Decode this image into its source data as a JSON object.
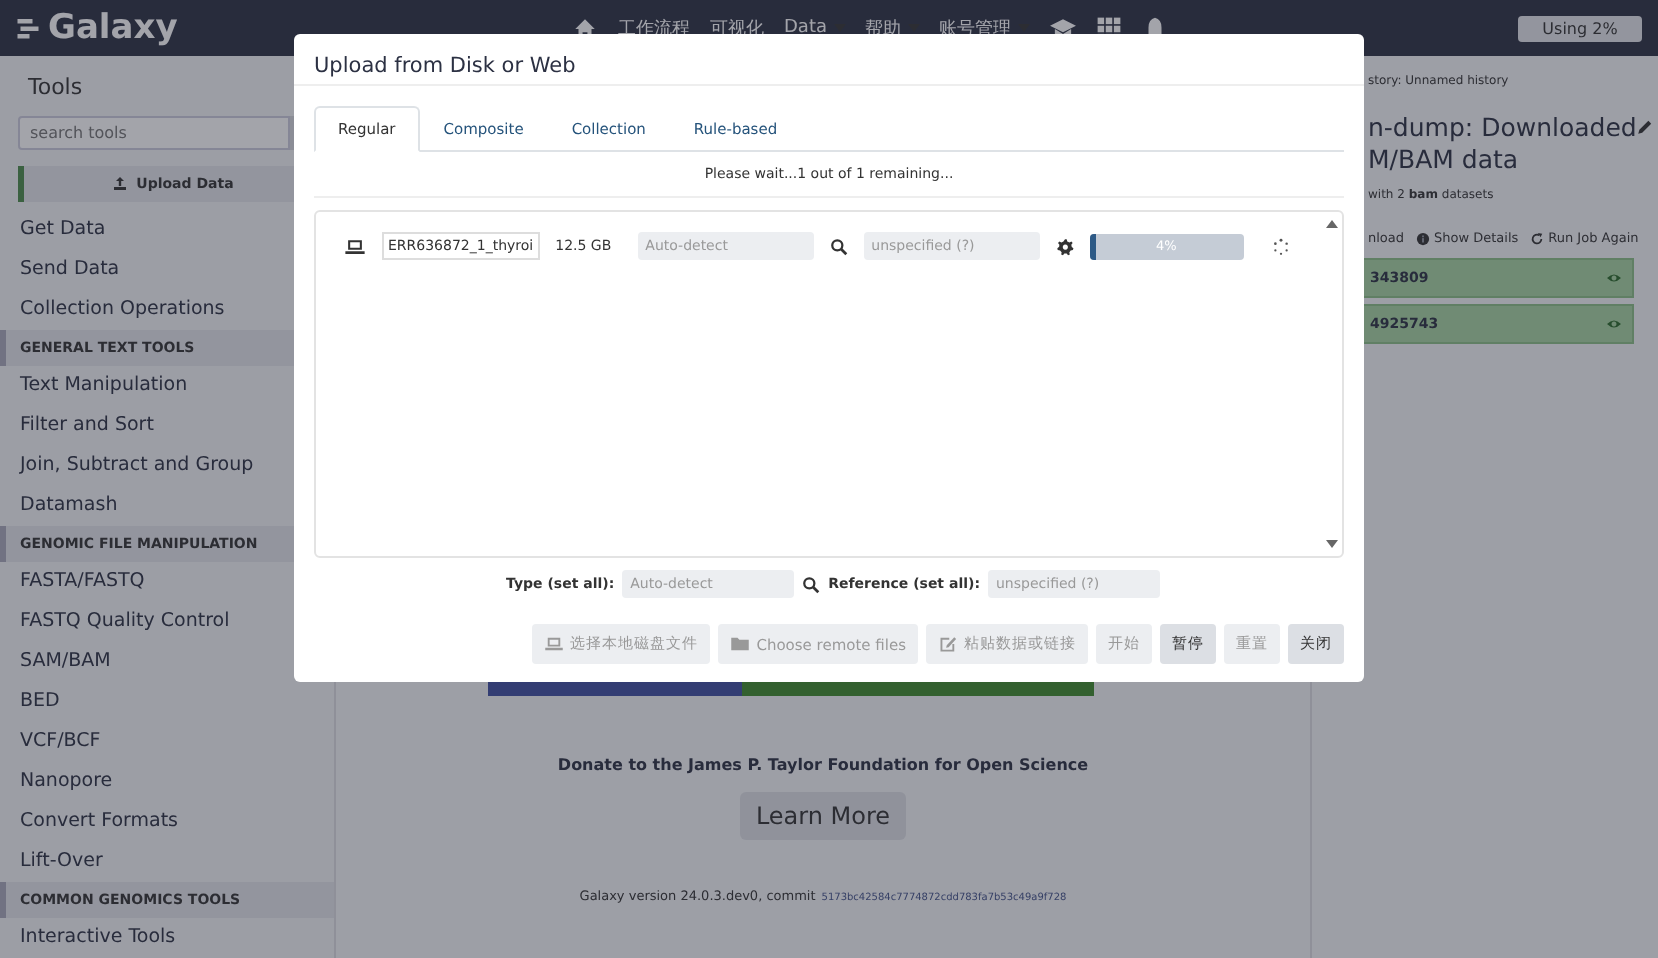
{
  "navbar": {
    "brand": "Galaxy",
    "items": [
      {
        "kind": "icon"
      },
      {
        "kind": "link",
        "label": "工作流程"
      },
      {
        "kind": "link",
        "label": "可视化"
      },
      {
        "kind": "menu",
        "label": "Data"
      },
      {
        "kind": "menu",
        "label": "帮助"
      },
      {
        "kind": "menu",
        "label": "账号管理"
      },
      {
        "kind": "icon"
      },
      {
        "kind": "icon"
      },
      {
        "kind": "icon"
      }
    ],
    "quota": "Using 2%"
  },
  "tool_panel": {
    "title": "Tools",
    "search": {
      "placeholder": "search tools"
    },
    "upload_button": "Upload Data",
    "items": [
      {
        "kind": "tool",
        "label": "Get Data"
      },
      {
        "kind": "tool",
        "label": "Send Data"
      },
      {
        "kind": "tool",
        "label": "Collection Operations"
      },
      {
        "kind": "section",
        "label": "GENERAL TEXT TOOLS"
      },
      {
        "kind": "tool",
        "label": "Text Manipulation"
      },
      {
        "kind": "tool",
        "label": "Filter and Sort"
      },
      {
        "kind": "tool",
        "label": "Join, Subtract and Group"
      },
      {
        "kind": "tool",
        "label": "Datamash"
      },
      {
        "kind": "section",
        "label": "GENOMIC FILE MANIPULATION"
      },
      {
        "kind": "tool",
        "label": "FASTA/FASTQ"
      },
      {
        "kind": "tool",
        "label": "FASTQ Quality Control"
      },
      {
        "kind": "tool",
        "label": "SAM/BAM"
      },
      {
        "kind": "tool",
        "label": "BED"
      },
      {
        "kind": "tool",
        "label": "VCF/BCF"
      },
      {
        "kind": "tool",
        "label": "Nanopore"
      },
      {
        "kind": "tool",
        "label": "Convert Formats"
      },
      {
        "kind": "tool",
        "label": "Lift-Over"
      },
      {
        "kind": "section",
        "label": "COMMON GENOMICS TOOLS"
      },
      {
        "kind": "tool",
        "label": "Interactive Tools"
      }
    ]
  },
  "center": {
    "donate_text": "Donate to the James P. Taylor Foundation for Open Science",
    "learn_more": "Learn More",
    "version": "Galaxy version 24.0.3.dev0, commit",
    "commit": "5173bc42584c7774872cdd783fa7b53c49a9f728"
  },
  "history": {
    "label": "story: Unnamed history",
    "title_lines": [
      "n-dump: Downloaded",
      "M/BAM data"
    ],
    "subtitle": "with 2 **bam** datasets",
    "actions": [
      {
        "label": "nload"
      },
      {
        "label": "Show Details"
      },
      {
        "label": "Run Job Again"
      }
    ],
    "datasets": [
      {
        "label": "343809"
      },
      {
        "label": "4925743"
      }
    ]
  },
  "dialog": {
    "title": "Upload from Disk or Web",
    "tabs": [
      {
        "label": "Regular",
        "selected": true
      },
      {
        "label": "Composite",
        "selected": false
      },
      {
        "label": "Collection",
        "selected": false
      },
      {
        "label": "Rule-based",
        "selected": false
      }
    ],
    "status": "Please wait...1 out of 1 remaining...",
    "uploads": [
      {
        "name": "ERR636872_1_thyroi",
        "size": "12.5 GB",
        "type": "Auto-detect",
        "reference": "unspecified (?)",
        "level": 0.04,
        "percent": "4%"
      }
    ],
    "type_label": "Type (set all):",
    "type_value": "Auto-detect",
    "reference_label": "Reference (set all):",
    "reference_value": "unspecified (?)",
    "buttons": [
      {
        "label": "选择本地磁盘文件",
        "disabled": true
      },
      {
        "label": "Choose remote files",
        "disabled": true
      },
      {
        "label": "粘贴数据或链接",
        "disabled": true
      },
      {
        "label": "开始",
        "disabled": true
      },
      {
        "label": "暂停",
        "disabled": false
      },
      {
        "label": "重置",
        "disabled": true
      },
      {
        "label": "关闭",
        "disabled": false
      }
    ]
  }
}
